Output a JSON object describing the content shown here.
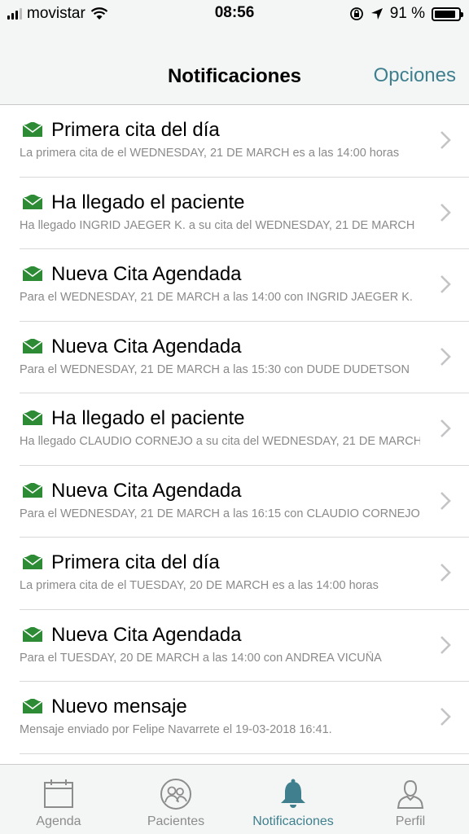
{
  "status_bar": {
    "carrier": "movistar",
    "time": "08:56",
    "battery": "91 %",
    "battery_level": 0.91
  },
  "header": {
    "title": "Notificaciones",
    "options_label": "Opciones"
  },
  "notifications": [
    {
      "title": "Primera cita del día",
      "subtitle": "La primera cita de el WEDNESDAY, 21 DE MARCH es a las 14:00 horas"
    },
    {
      "title": "Ha llegado el paciente",
      "subtitle": "Ha llegado INGRID JAEGER K. a su cita del WEDNESDAY, 21 DE MARCH"
    },
    {
      "title": "Nueva Cita Agendada",
      "subtitle": "Para el WEDNESDAY, 21 DE MARCH a las 14:00 con INGRID JAEGER K."
    },
    {
      "title": "Nueva Cita Agendada",
      "subtitle": "Para el WEDNESDAY, 21 DE MARCH a las 15:30 con DUDE DUDETSON"
    },
    {
      "title": "Ha llegado el paciente",
      "subtitle": "Ha llegado CLAUDIO CORNEJO a su cita del WEDNESDAY, 21 DE MARCH"
    },
    {
      "title": "Nueva Cita Agendada",
      "subtitle": "Para el WEDNESDAY, 21 DE MARCH a las 16:15 con CLAUDIO CORNEJO"
    },
    {
      "title": "Primera cita del día",
      "subtitle": "La primera cita de el TUESDAY, 20 DE MARCH es a las 14:00 horas"
    },
    {
      "title": "Nueva Cita Agendada",
      "subtitle": "Para el TUESDAY, 20 DE MARCH a las 14:00 con ANDREA VICUÑA"
    },
    {
      "title": "Nuevo mensaje",
      "subtitle": "Mensaje enviado por Felipe Navarrete el 19-03-2018 16:41."
    }
  ],
  "tabs": [
    {
      "label": "Agenda",
      "icon": "calendar-icon"
    },
    {
      "label": "Pacientes",
      "icon": "patients-icon"
    },
    {
      "label": "Notificaciones",
      "icon": "bell-icon"
    },
    {
      "label": "Perfil",
      "icon": "profile-icon"
    }
  ],
  "colors": {
    "accent": "#3f7f8e",
    "envelope": "#2e8b35",
    "tab_inactive": "#8c8c8c"
  }
}
